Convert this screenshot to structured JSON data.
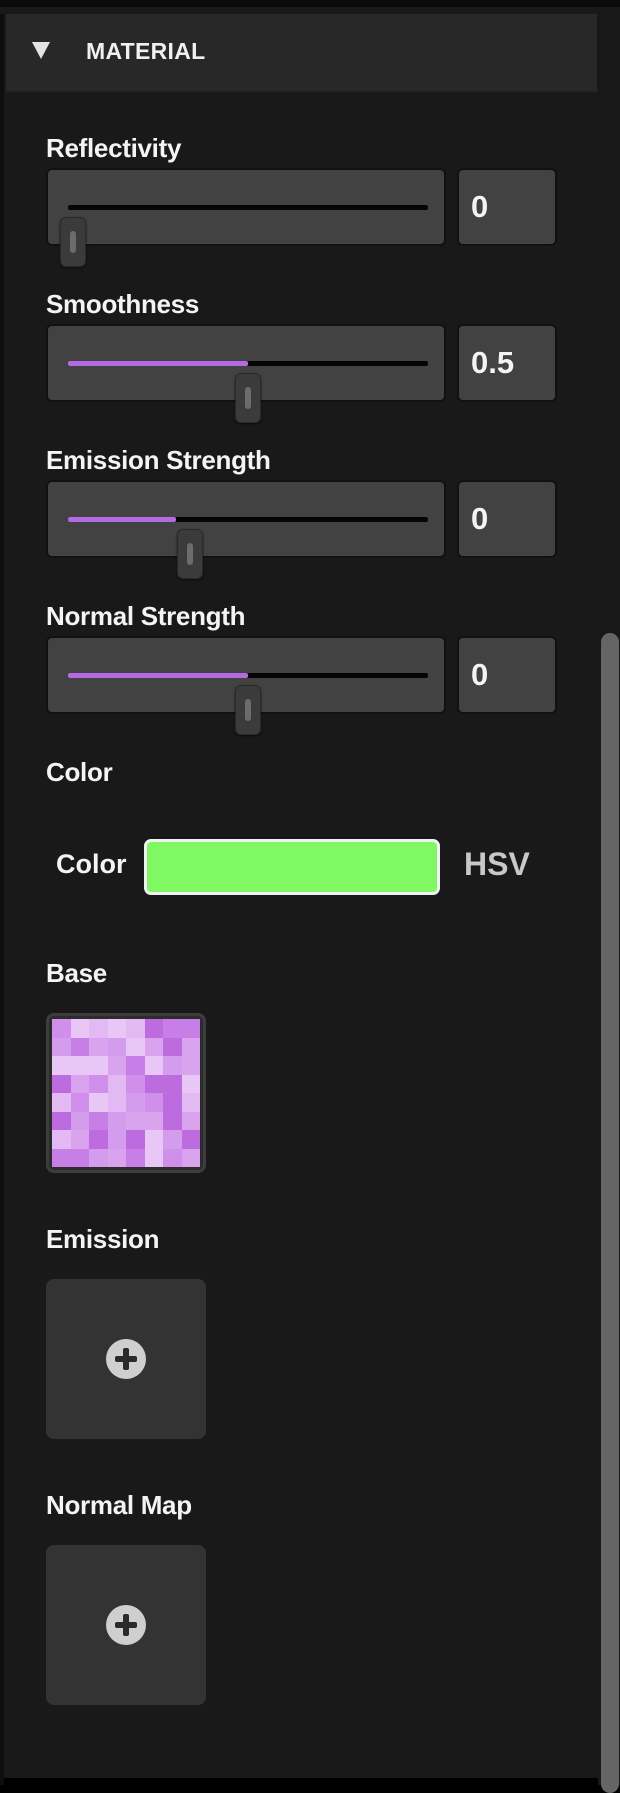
{
  "section": {
    "title": "MATERIAL",
    "collapse_icon": "triangle-down-icon"
  },
  "sliders": [
    {
      "label": "Reflectivity",
      "value_text": "0",
      "fill": 0.0,
      "thumb": 0.0
    },
    {
      "label": "Smoothness",
      "value_text": "0.5",
      "fill": 0.5,
      "thumb": 0.5
    },
    {
      "label": "Emission Strength",
      "value_text": "0",
      "fill": 0.3,
      "thumb": 0.34
    },
    {
      "label": "Normal Strength",
      "value_text": "0",
      "fill": 0.5,
      "thumb": 0.5
    }
  ],
  "color_section": {
    "heading": "Color",
    "row_label": "Color",
    "swatch_color": "#80f863",
    "mode": "HSV"
  },
  "textures": {
    "base": {
      "label": "Base",
      "icon": "purple-checker-texture"
    },
    "emission": {
      "label": "Emission",
      "icon": "plus-icon"
    },
    "normal_map": {
      "label": "Normal Map",
      "icon": "plus-icon"
    }
  },
  "colors": {
    "accent": "#b46ae0",
    "panel_bg": "#191919",
    "control_bg": "#424242"
  }
}
